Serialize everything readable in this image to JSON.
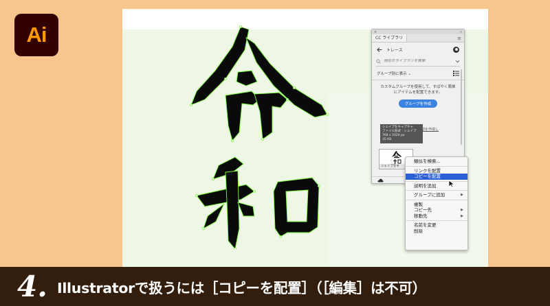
{
  "app_logo": {
    "text": "Ai",
    "bg": "#330000",
    "fg": "#ff9a00"
  },
  "colors": {
    "page_bg": "#f8c58c",
    "artboard": "#eef7e6",
    "accent": "#3a83e0",
    "menu_highlight": "#2c5fd6",
    "caption_bg": "#331d0c"
  },
  "artwork": {
    "characters": [
      "令",
      "和"
    ],
    "selection_color": "#7cff3a"
  },
  "panel": {
    "tab": "CC ライブラリ",
    "library_name": "トレース",
    "search_placeholder": "現在のライブラリを検索",
    "group_view": "グループ別に表示",
    "message": "カスタムグループを使用して、すばやく簡単にアイテムを配置できます。",
    "create_group_button": "グループを作成",
    "tooltip_lines": [
      "シェイプをキャプチャ",
      "ファイル形式 : シェイプ",
      "768 x 1024 px",
      "35 KB"
    ],
    "behind_link": "助を作成し",
    "thumbnail_label": "シェイプをキ"
  },
  "context_menu": {
    "items": [
      {
        "label": "類似を検索...",
        "arrow": ""
      },
      {
        "label": "リンクを配置",
        "arrow": ""
      },
      {
        "label": "コピーを配置",
        "arrow": "",
        "active": true
      },
      {
        "label": "説明を追加",
        "arrow": ""
      },
      {
        "label": "グループに追加",
        "arrow": "▶"
      },
      {
        "label": "複製",
        "arrow": ""
      },
      {
        "label": "コピー先",
        "arrow": "▶"
      },
      {
        "label": "移動先",
        "arrow": "▶"
      },
      {
        "label": "名前を変更",
        "arrow": ""
      },
      {
        "label": "削除",
        "arrow": ""
      }
    ]
  },
  "caption": {
    "step": "4.",
    "text": "Illustratorで扱うには［コピーを配置］（［編集］は不可）"
  }
}
